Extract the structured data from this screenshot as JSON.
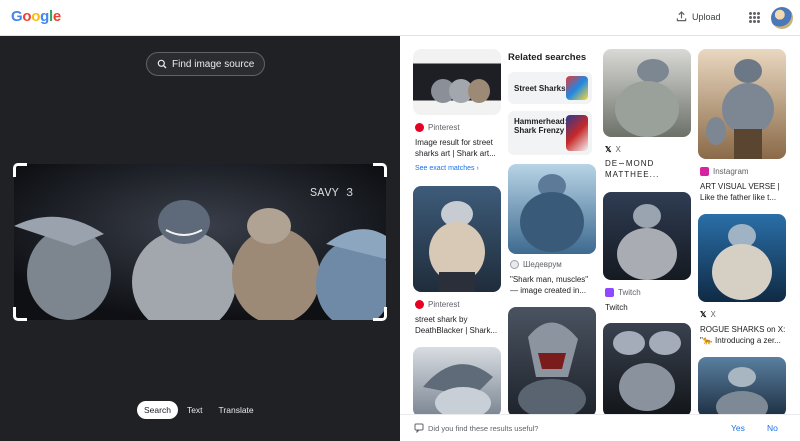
{
  "header": {
    "upload_label": "Upload"
  },
  "left_panel": {
    "find_source_label": "Find image source",
    "crop_text": "SAVY 3",
    "modes": [
      "Search",
      "Text",
      "Translate"
    ],
    "active_mode": "Search"
  },
  "results": {
    "col1": [
      {
        "source": "Pinterest",
        "caption": "Image result for street sharks art | Shark art...",
        "exact_label": "See exact matches"
      },
      {
        "source": "Pinterest",
        "caption": "street shark by DeathBlacker | Shark..."
      }
    ],
    "related": {
      "title": "Related searches",
      "items": [
        "Street Sharks",
        "Hammerhead: Shark Frenzy"
      ]
    },
    "col2": [
      {
        "source": "Шедеврум",
        "caption": "\"Shark man, muscles\" — image created in..."
      }
    ],
    "col3": [
      {
        "source": "X",
        "caption": "DE∽MOND MATTHEE..."
      },
      {
        "source": "Twitch",
        "caption": "Twitch"
      }
    ],
    "col4": [
      {
        "source": "Instagram",
        "caption": "ART VISUAL VERSE | Like the father like t..."
      },
      {
        "source": "X",
        "caption": "ROGUE SHARKS on X: \"🐆 Introducing a zer..."
      }
    ]
  },
  "feedback": {
    "question": "Did you find these results useful?",
    "yes": "Yes",
    "no": "No"
  },
  "colors": {
    "accent": "#1a73e8",
    "dark_panel": "#202124",
    "pinterest": "#e60023",
    "twitch": "#9146ff",
    "instagram": "#d6249f"
  }
}
